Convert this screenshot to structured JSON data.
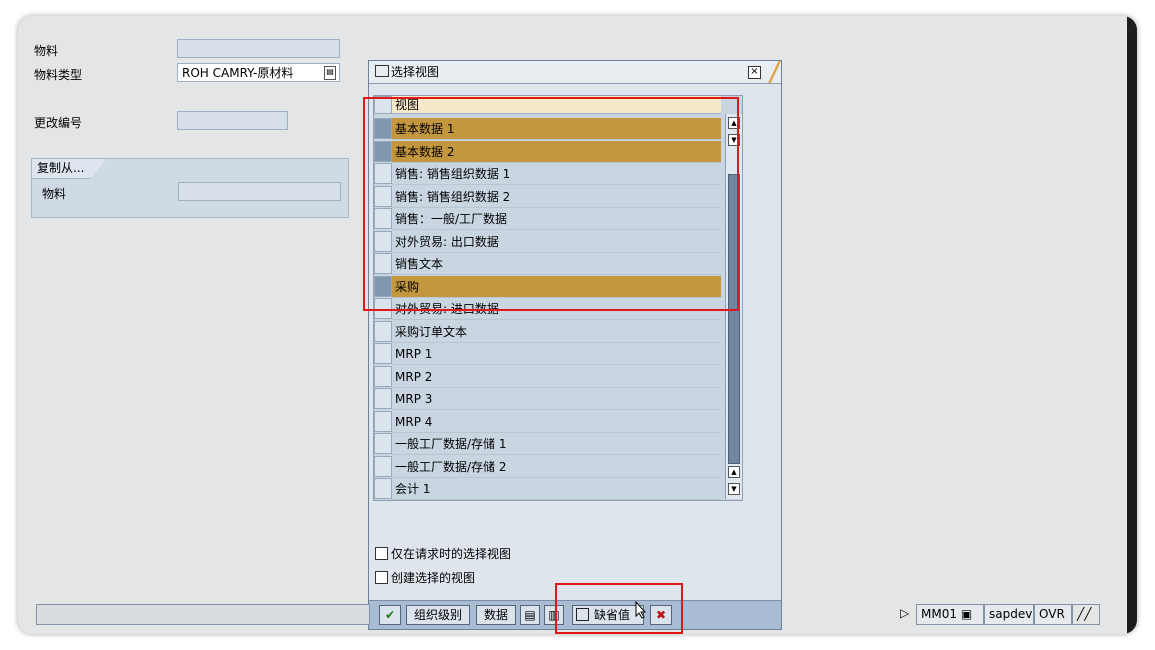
{
  "form": {
    "material_label": "物料",
    "material_value": "",
    "material_type_label": "物料类型",
    "material_type_value": "ROH CAMRY-原材料",
    "change_number_label": "更改编号",
    "change_number_value": "",
    "copy_from_title": "复制从...",
    "copy_material_label": "物料",
    "copy_material_value": ""
  },
  "dialog": {
    "title": "选择视图",
    "column_header": "视图",
    "rows": [
      {
        "label": "基本数据 1",
        "selected": true
      },
      {
        "label": "基本数据 2",
        "selected": true
      },
      {
        "label": "销售: 销售组织数据 1",
        "selected": false
      },
      {
        "label": "销售: 销售组织数据 2",
        "selected": false
      },
      {
        "label": "销售：一般/工厂数据",
        "selected": false
      },
      {
        "label": "对外贸易: 出口数据",
        "selected": false
      },
      {
        "label": "销售文本",
        "selected": false
      },
      {
        "label": "采购",
        "selected": true
      },
      {
        "label": "对外贸易: 进口数据",
        "selected": false
      },
      {
        "label": "采购订单文本",
        "selected": false
      },
      {
        "label": "MRP 1",
        "selected": false
      },
      {
        "label": "MRP 2",
        "selected": false
      },
      {
        "label": "MRP 3",
        "selected": false
      },
      {
        "label": "MRP 4",
        "selected": false
      },
      {
        "label": "一般工厂数据/存储 1",
        "selected": false
      },
      {
        "label": "一般工厂数据/存储 2",
        "selected": false
      },
      {
        "label": "会计 1",
        "selected": false
      }
    ],
    "checkbox_only_on_request": "仅在请求时的选择视图",
    "checkbox_create_selected": "创建选择的视图",
    "buttons": {
      "ok_icon": "✔",
      "org_levels": "组织级别",
      "data": "数据",
      "default": "缺省值",
      "cancel_icon": "✖"
    }
  },
  "status": {
    "transaction": "MM01",
    "system": "sapdev",
    "mode": "OVR"
  },
  "colors": {
    "selected_row": "#c4973e",
    "annotation_red": "#e01818",
    "dialog_toolbar": "#a8bcd4"
  }
}
